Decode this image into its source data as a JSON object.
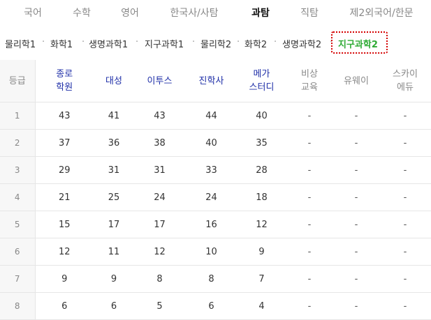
{
  "subject_tabs": [
    {
      "label": "국어",
      "active": false
    },
    {
      "label": "수학",
      "active": false
    },
    {
      "label": "영어",
      "active": false
    },
    {
      "label": "한국사/사탐",
      "active": false
    },
    {
      "label": "과탐",
      "active": true
    },
    {
      "label": "직탐",
      "active": false
    },
    {
      "label": "제2외국어/한문",
      "active": false
    }
  ],
  "sub_tabs": [
    {
      "label": "물리학1",
      "active": false
    },
    {
      "label": "화학1",
      "active": false
    },
    {
      "label": "생명과학1",
      "active": false
    },
    {
      "label": "지구과학1",
      "active": false
    },
    {
      "label": "물리학2",
      "active": false
    },
    {
      "label": "화학2",
      "active": false
    },
    {
      "label": "생명과학2",
      "active": false
    },
    {
      "label": "지구과학2",
      "active": true
    }
  ],
  "separator": "·",
  "table": {
    "headers": [
      {
        "lines": [
          "등급"
        ],
        "kind": "grade"
      },
      {
        "lines": [
          "종로",
          "학원"
        ],
        "kind": "pub"
      },
      {
        "lines": [
          "대성"
        ],
        "kind": "pub"
      },
      {
        "lines": [
          "이투스"
        ],
        "kind": "pub"
      },
      {
        "lines": [
          "진학사"
        ],
        "kind": "pub"
      },
      {
        "lines": [
          "메가",
          "스터디"
        ],
        "kind": "pub"
      },
      {
        "lines": [
          "비상",
          "교육"
        ],
        "kind": "dim"
      },
      {
        "lines": [
          "유웨이"
        ],
        "kind": "dim"
      },
      {
        "lines": [
          "스카이",
          "에듀"
        ],
        "kind": "dim"
      }
    ],
    "rows": [
      [
        "1",
        "43",
        "41",
        "43",
        "44",
        "40",
        "-",
        "-",
        "-"
      ],
      [
        "2",
        "37",
        "36",
        "38",
        "40",
        "35",
        "-",
        "-",
        "-"
      ],
      [
        "3",
        "29",
        "31",
        "31",
        "33",
        "28",
        "-",
        "-",
        "-"
      ],
      [
        "4",
        "21",
        "25",
        "24",
        "24",
        "18",
        "-",
        "-",
        "-"
      ],
      [
        "5",
        "15",
        "17",
        "17",
        "16",
        "12",
        "-",
        "-",
        "-"
      ],
      [
        "6",
        "12",
        "11",
        "12",
        "10",
        "9",
        "-",
        "-",
        "-"
      ],
      [
        "7",
        "9",
        "9",
        "8",
        "8",
        "7",
        "-",
        "-",
        "-"
      ],
      [
        "8",
        "6",
        "6",
        "5",
        "6",
        "4",
        "-",
        "-",
        "-"
      ]
    ]
  },
  "colors": {
    "active_sub": "#2eaa34",
    "publisher_header": "#1f2fa8",
    "highlight_border": "#d40000"
  }
}
